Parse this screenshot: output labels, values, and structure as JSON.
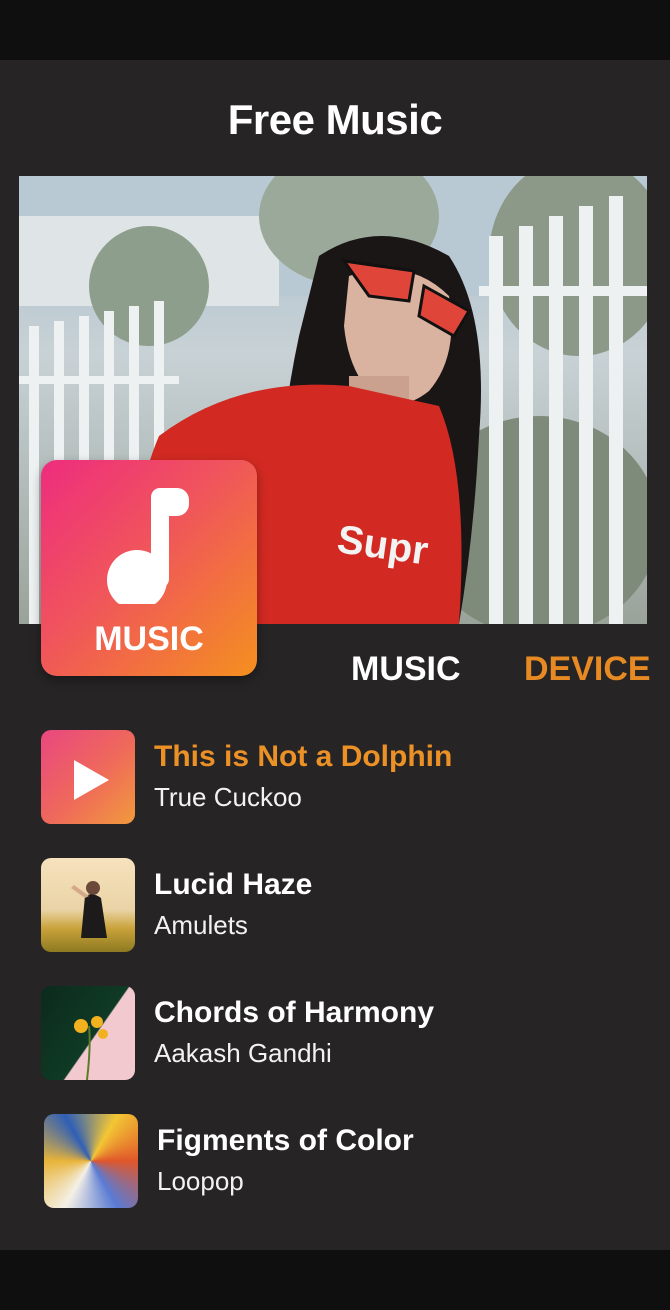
{
  "app": {
    "title": "Free Music"
  },
  "logo": {
    "label": "MUSIC",
    "icon": "music-note-icon"
  },
  "tabs": [
    {
      "label": "MUSIC",
      "active": false
    },
    {
      "label": "DEVICE",
      "active": true
    }
  ],
  "tracks": [
    {
      "title": "This is Not a Dolphin",
      "artist": "True Cuckoo",
      "playing": true
    },
    {
      "title": "Lucid Haze",
      "artist": "Amulets",
      "playing": false
    },
    {
      "title": "Chords of Harmony",
      "artist": "Aakash Gandhi",
      "playing": false
    },
    {
      "title": "Figments of Color",
      "artist": "Loopop",
      "playing": false
    }
  ],
  "colors": {
    "background": "#262425",
    "accent": "#e88a23",
    "logo_gradient_start": "#ee2d7e",
    "logo_gradient_end": "#f4901f"
  }
}
